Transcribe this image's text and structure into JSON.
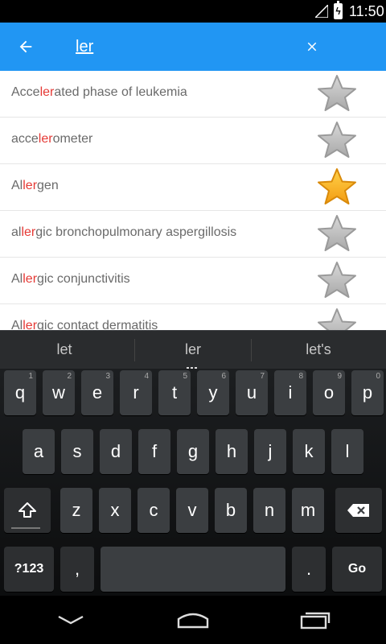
{
  "status_bar": {
    "time": "11:50"
  },
  "search": {
    "query": "ler"
  },
  "results": [
    {
      "pre": "Acce",
      "match": "ler",
      "post": "ated phase of leukemia",
      "favorite": false
    },
    {
      "pre": "acce",
      "match": "ler",
      "post": "ometer",
      "favorite": false
    },
    {
      "pre": "Al",
      "match": "ler",
      "post": "gen",
      "favorite": true
    },
    {
      "pre": "al",
      "match": "ler",
      "post": "gic bronchopulmonary aspergillosis",
      "favorite": false
    },
    {
      "pre": "Al",
      "match": "ler",
      "post": "gic conjunctivitis",
      "favorite": false
    },
    {
      "pre": "Al",
      "match": "ler",
      "post": "gic contact dermatitis",
      "favorite": false
    }
  ],
  "keyboard": {
    "suggestions": [
      "let",
      "ler",
      "let's"
    ],
    "row1": [
      {
        "k": "q",
        "h": "1"
      },
      {
        "k": "w",
        "h": "2"
      },
      {
        "k": "e",
        "h": "3"
      },
      {
        "k": "r",
        "h": "4"
      },
      {
        "k": "t",
        "h": "5"
      },
      {
        "k": "y",
        "h": "6"
      },
      {
        "k": "u",
        "h": "7"
      },
      {
        "k": "i",
        "h": "8"
      },
      {
        "k": "o",
        "h": "9"
      },
      {
        "k": "p",
        "h": "0"
      }
    ],
    "row2": [
      "a",
      "s",
      "d",
      "f",
      "g",
      "h",
      "j",
      "k",
      "l"
    ],
    "row3": [
      "z",
      "x",
      "c",
      "v",
      "b",
      "n",
      "m"
    ],
    "symbols_label": "?123",
    "comma_label": ",",
    "period_label": ".",
    "go_label": "Go"
  },
  "colors": {
    "accent": "#2196F3",
    "highlight": "#e53935",
    "star_on": "#f5a623",
    "star_off": "#c0c0c0"
  }
}
